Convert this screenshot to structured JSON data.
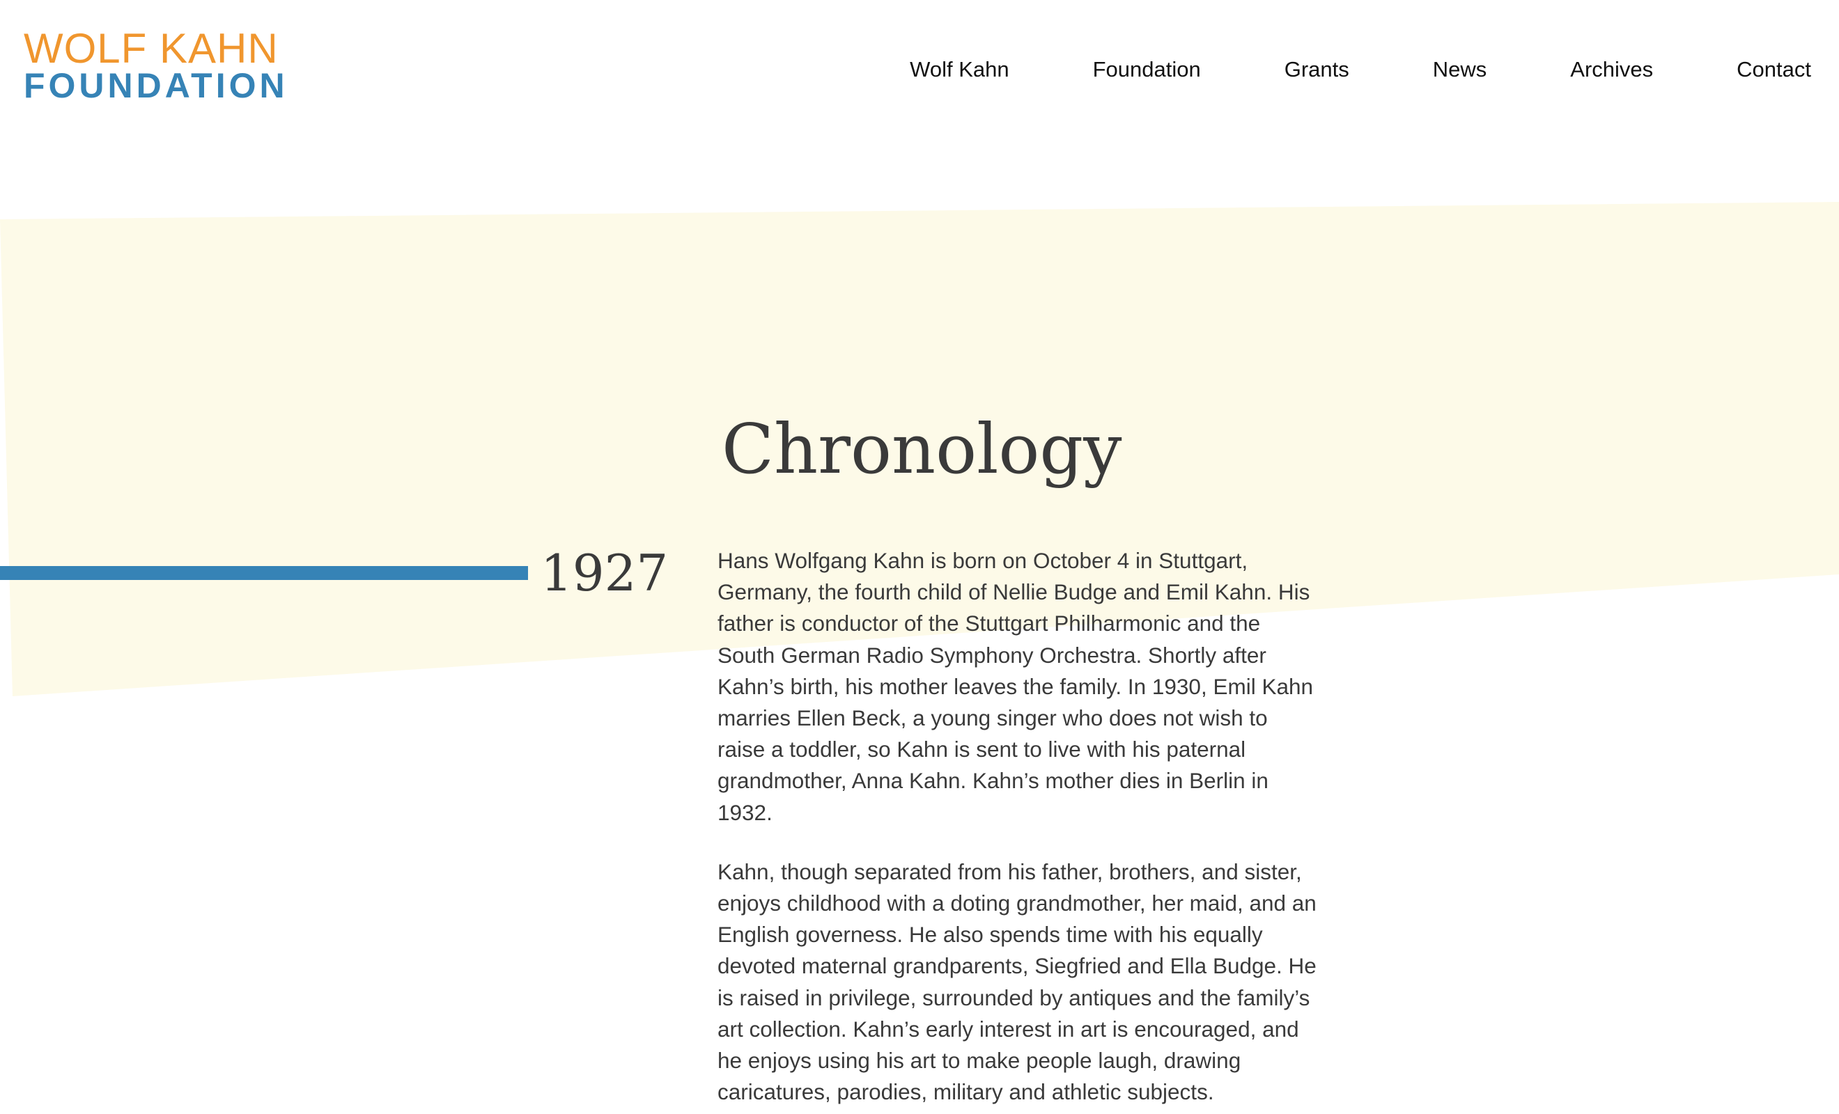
{
  "header": {
    "logo": {
      "line1": "WOLF KAHN",
      "line2": "FOUNDATION"
    },
    "nav": [
      {
        "label": "Wolf Kahn"
      },
      {
        "label": "Foundation"
      },
      {
        "label": "Grants"
      },
      {
        "label": "News"
      },
      {
        "label": "Archives"
      },
      {
        "label": "Contact"
      }
    ]
  },
  "page": {
    "title": "Chronology"
  },
  "timeline": {
    "year": "1927",
    "paragraphs": [
      "Hans Wolfgang Kahn is born on October 4 in Stuttgart, Germany, the fourth child of Nellie Budge and Emil Kahn. His father is conductor of the Stuttgart Philharmonic and the South German Radio Symphony Orchestra. Shortly after Kahn’s birth, his mother leaves the family. In 1930, Emil Kahn marries Ellen Beck, a young singer who does not wish to raise a toddler, so Kahn is sent to live with his paternal grandmother, Anna Kahn. Kahn’s mother dies in Berlin in 1932.",
      "Kahn, though separated from his father, brothers, and sister, enjoys childhood with a doting grandmother, her maid, and an English governess. He also spends time with his equally devoted maternal grandparents, Siegfried and Ella Budge. He is raised in privilege, surrounded by antiques and the family’s art collection. Kahn’s early interest in art is encouraged, and he enjoys using his art to make people laugh, drawing caricatures, parodies, military and athletic subjects."
    ]
  },
  "colors": {
    "logo_orange": "#F0962E",
    "brand_blue": "#3683B6",
    "band_yellow": "#FDFAE8",
    "text": "#3a3a3a",
    "nav_text": "#111111"
  }
}
